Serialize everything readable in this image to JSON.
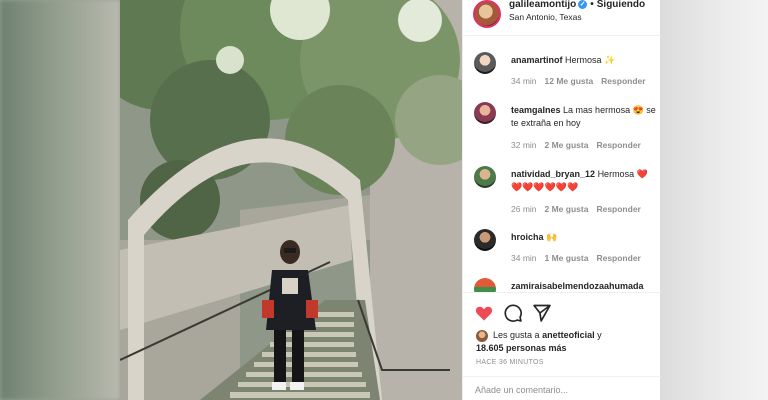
{
  "post": {
    "username": "galileamontijo",
    "separator": "•",
    "follow_label": "Siguiendo",
    "location": "San Antonio, Texas"
  },
  "comments": [
    {
      "username": "anamartinof",
      "text": "Hermosa ✨",
      "time": "34 min",
      "likes": "12 Me gusta",
      "reply": "Responder"
    },
    {
      "username": "teamgalnes",
      "text": "La mas hermosa 😍 se te extraña en hoy",
      "time": "32 min",
      "likes": "2 Me gusta",
      "reply": "Responder"
    },
    {
      "username": "natividad_bryan_12",
      "text": "Hermosa ❤️ ❤️❤️❤️❤️❤️❤️",
      "time": "26 min",
      "likes": "2 Me gusta",
      "reply": "Responder"
    },
    {
      "username": "hroicha",
      "text": "🙌",
      "time": "34 min",
      "likes": "1 Me gusta",
      "reply": "Responder"
    },
    {
      "username": "zamiraisabelmendozaahumada",
      "text": "",
      "time": "",
      "likes": "",
      "reply": ""
    }
  ],
  "likes": {
    "prefix": "Les gusta a",
    "user": "anetteoficial",
    "joiner": "y",
    "count": "18.605 personas más"
  },
  "time_ago": "HACE 36 MINUTOS",
  "add_comment": {
    "placeholder": "Añade un comentario..."
  },
  "icons": {
    "like": "heart-icon",
    "comment": "comment-icon",
    "share": "share-icon"
  },
  "colors": {
    "like": "#ed4956",
    "verified": "#3897f0",
    "meta": "#8e8e8e",
    "text": "#262626"
  }
}
